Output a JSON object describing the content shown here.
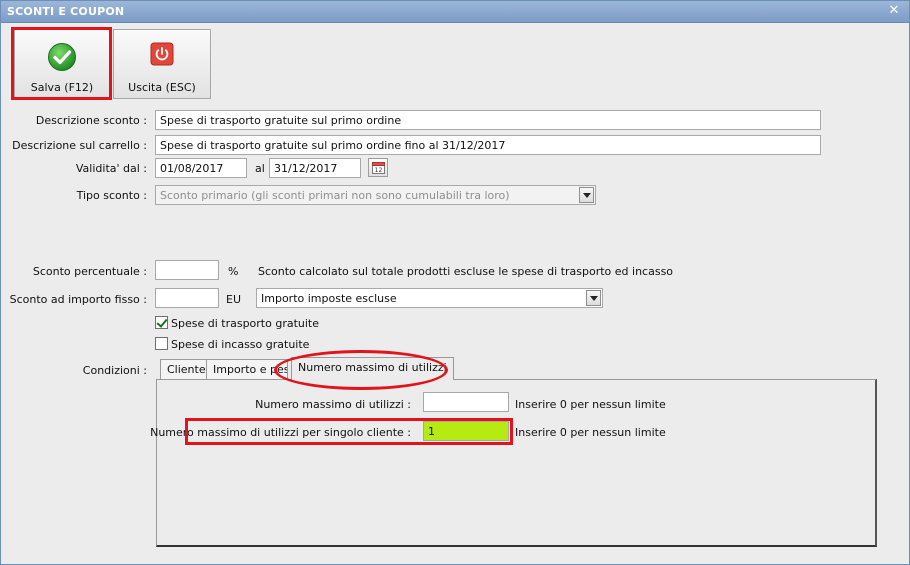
{
  "window": {
    "title": "SCONTI E COUPON"
  },
  "toolbar": {
    "save_label": "Salva (F12)",
    "exit_label": "Uscita (ESC)"
  },
  "form": {
    "descrizione_label": "Descrizione sconto :",
    "descrizione_value": "Spese di trasporto gratuite sul primo ordine",
    "carrello_label": "Descrizione sul carrello :",
    "carrello_value": "Spese di trasporto gratuite sul primo ordine fino al 31/12/2017",
    "validita_label": "Validita' dal :",
    "validita_dal": "01/08/2017",
    "al_label": "al",
    "validita_al": "31/12/2017",
    "tipo_label": "Tipo sconto :",
    "tipo_value": "Sconto primario (gli sconti primari non sono cumulabili tra loro)",
    "percentuale_label": "Sconto percentuale :",
    "percentuale_value": "",
    "percent_unit": "%",
    "percentuale_note": "Sconto calcolato sul totale prodotti escluse le spese di trasporto ed incasso",
    "importo_label": "Sconto ad importo fisso :",
    "importo_value": "",
    "importo_unit": "EU",
    "importo_mode": "Importo imposte escluse",
    "trasporto_label": "Spese di trasporto gratuite",
    "trasporto_checked": true,
    "incasso_label": "Spese di incasso gratuite",
    "incasso_checked": false,
    "condizioni_label": "Condizioni :"
  },
  "tabs": [
    {
      "label": "Cliente"
    },
    {
      "label": "Importo e peso"
    },
    {
      "label": "Numero massimo di utilizzi"
    }
  ],
  "tab_content": {
    "max_label": "Numero massimo di utilizzi :",
    "max_value": "",
    "max_hint": "Inserire 0 per nessun limite",
    "max_cliente_label": "Numero massimo di utilizzi per singolo cliente :",
    "max_cliente_value": "1",
    "max_cliente_hint": "Inserire 0 per nessun limite"
  },
  "colors": {
    "highlight": "#e3121b",
    "field_active": "#b5ea12",
    "save_icon": "#2ea02e",
    "exit_icon": "#e2463a"
  }
}
